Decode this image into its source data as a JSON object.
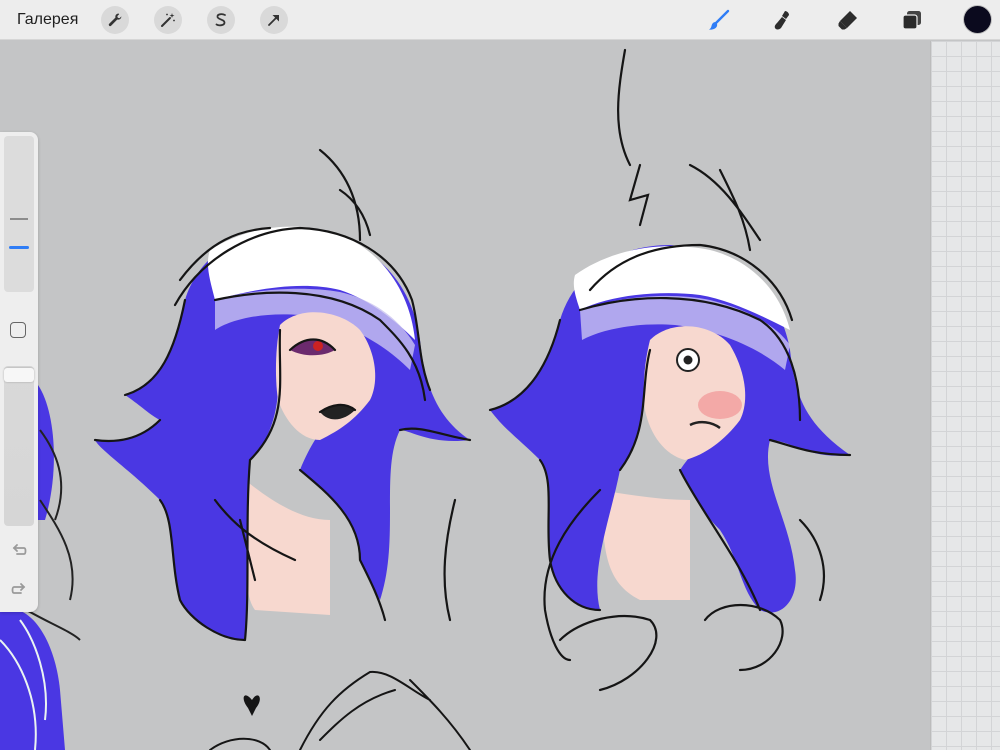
{
  "topbar": {
    "gallery_label": "Галерея",
    "left_tools": [
      {
        "icon": "wrench-icon",
        "name": "actions"
      },
      {
        "icon": "magic-wand-icon",
        "name": "adjustments"
      },
      {
        "icon": "selection-s-icon",
        "name": "selection"
      },
      {
        "icon": "transform-arrow-icon",
        "name": "transform"
      }
    ],
    "right_tools": [
      {
        "icon": "brush-icon",
        "name": "paint",
        "active": true
      },
      {
        "icon": "smudge-icon",
        "name": "smudge"
      },
      {
        "icon": "eraser-icon",
        "name": "eraser"
      },
      {
        "icon": "layers-icon",
        "name": "layers"
      }
    ],
    "current_color": "#0b0a1e",
    "active_tool_color": "#2f7df6"
  },
  "sidebar": {
    "brush_size_level": 0.7,
    "opacity_level": 1.0
  },
  "canvas": {
    "background": "#c4c5c6",
    "hair_color": "#4a37e3",
    "skin_color": "#f7d8cf"
  }
}
